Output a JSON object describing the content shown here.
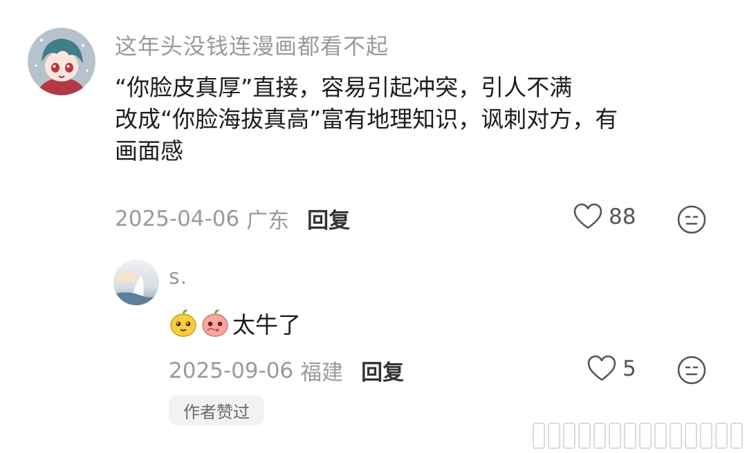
{
  "main_comment": {
    "username": "这年头没钱连漫画都看不起",
    "lines": [
      "“你脸皮真厚”直接，容易引起冲突，引人不满",
      "改成“你脸海拔真高”富有地理知识，讽刺对方，有",
      "画面感"
    ],
    "date": "2025-04-06",
    "location": "广东",
    "reply_label": "回复",
    "like_count": "88"
  },
  "reply_comment": {
    "username": "s.",
    "text": "太牛了",
    "stickers": [
      "yellow-face-sticker",
      "pink-face-sticker"
    ],
    "date": "2025-09-06",
    "location": "福建",
    "reply_label": "回复",
    "like_count": "5",
    "badge": "作者赞过"
  },
  "icons": {
    "like": "heart-outline-icon",
    "react": "neutral-face-icon"
  },
  "colors": {
    "secondary_text": "#9a9a9a",
    "primary_text": "#1c1c1c",
    "badge_bg": "#f2f2f2"
  }
}
